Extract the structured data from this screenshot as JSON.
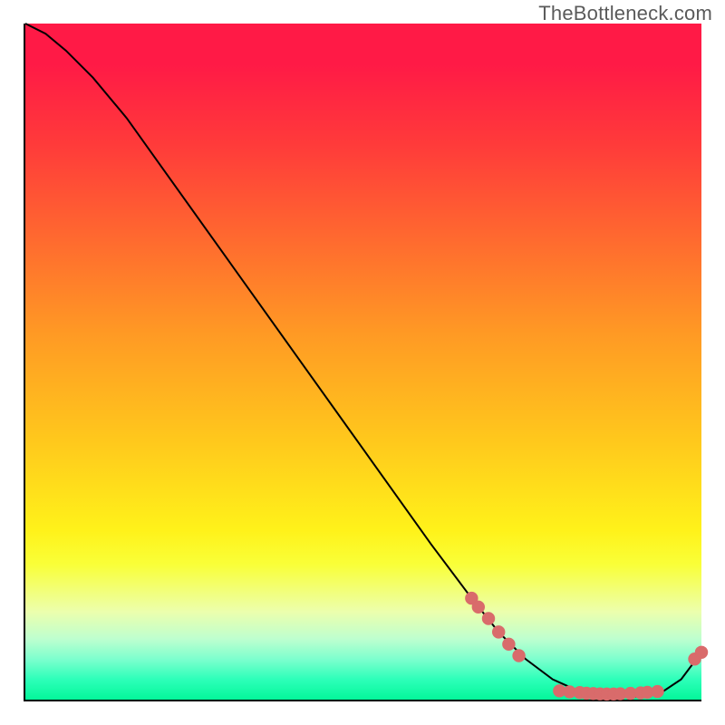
{
  "watermark": "TheBottleneck.com",
  "chart_data": {
    "type": "line",
    "title": "",
    "xlabel": "",
    "ylabel": "",
    "xlim": [
      0,
      100
    ],
    "ylim": [
      0,
      100
    ],
    "grid": false,
    "legend": false,
    "series": [
      {
        "name": "curve",
        "x": [
          0,
          3,
          6,
          10,
          15,
          20,
          30,
          40,
          50,
          60,
          66,
          70,
          74,
          78,
          82,
          86,
          90,
          94,
          97,
          100
        ],
        "y": [
          100,
          98.5,
          96,
          92,
          86,
          79,
          65,
          51,
          37,
          23,
          15,
          10,
          6,
          3,
          1.2,
          0.6,
          0.4,
          1.0,
          3.0,
          7
        ]
      }
    ],
    "markers": [
      {
        "x": 66,
        "y": 15.0
      },
      {
        "x": 67,
        "y": 13.7
      },
      {
        "x": 68.5,
        "y": 12.0
      },
      {
        "x": 70,
        "y": 10.0
      },
      {
        "x": 71.5,
        "y": 8.2
      },
      {
        "x": 73,
        "y": 6.5
      },
      {
        "x": 79,
        "y": 1.3
      },
      {
        "x": 80.5,
        "y": 1.15
      },
      {
        "x": 82,
        "y": 1.05
      },
      {
        "x": 83,
        "y": 0.95
      },
      {
        "x": 84,
        "y": 0.9
      },
      {
        "x": 85,
        "y": 0.85
      },
      {
        "x": 86,
        "y": 0.82
      },
      {
        "x": 87,
        "y": 0.83
      },
      {
        "x": 88,
        "y": 0.86
      },
      {
        "x": 89.5,
        "y": 0.92
      },
      {
        "x": 91,
        "y": 1.0
      },
      {
        "x": 92,
        "y": 1.08
      },
      {
        "x": 93.5,
        "y": 1.2
      },
      {
        "x": 99,
        "y": 6.0
      },
      {
        "x": 100,
        "y": 7.0
      }
    ],
    "colors": {
      "marker": "#d96b6b",
      "line": "#000000"
    }
  }
}
